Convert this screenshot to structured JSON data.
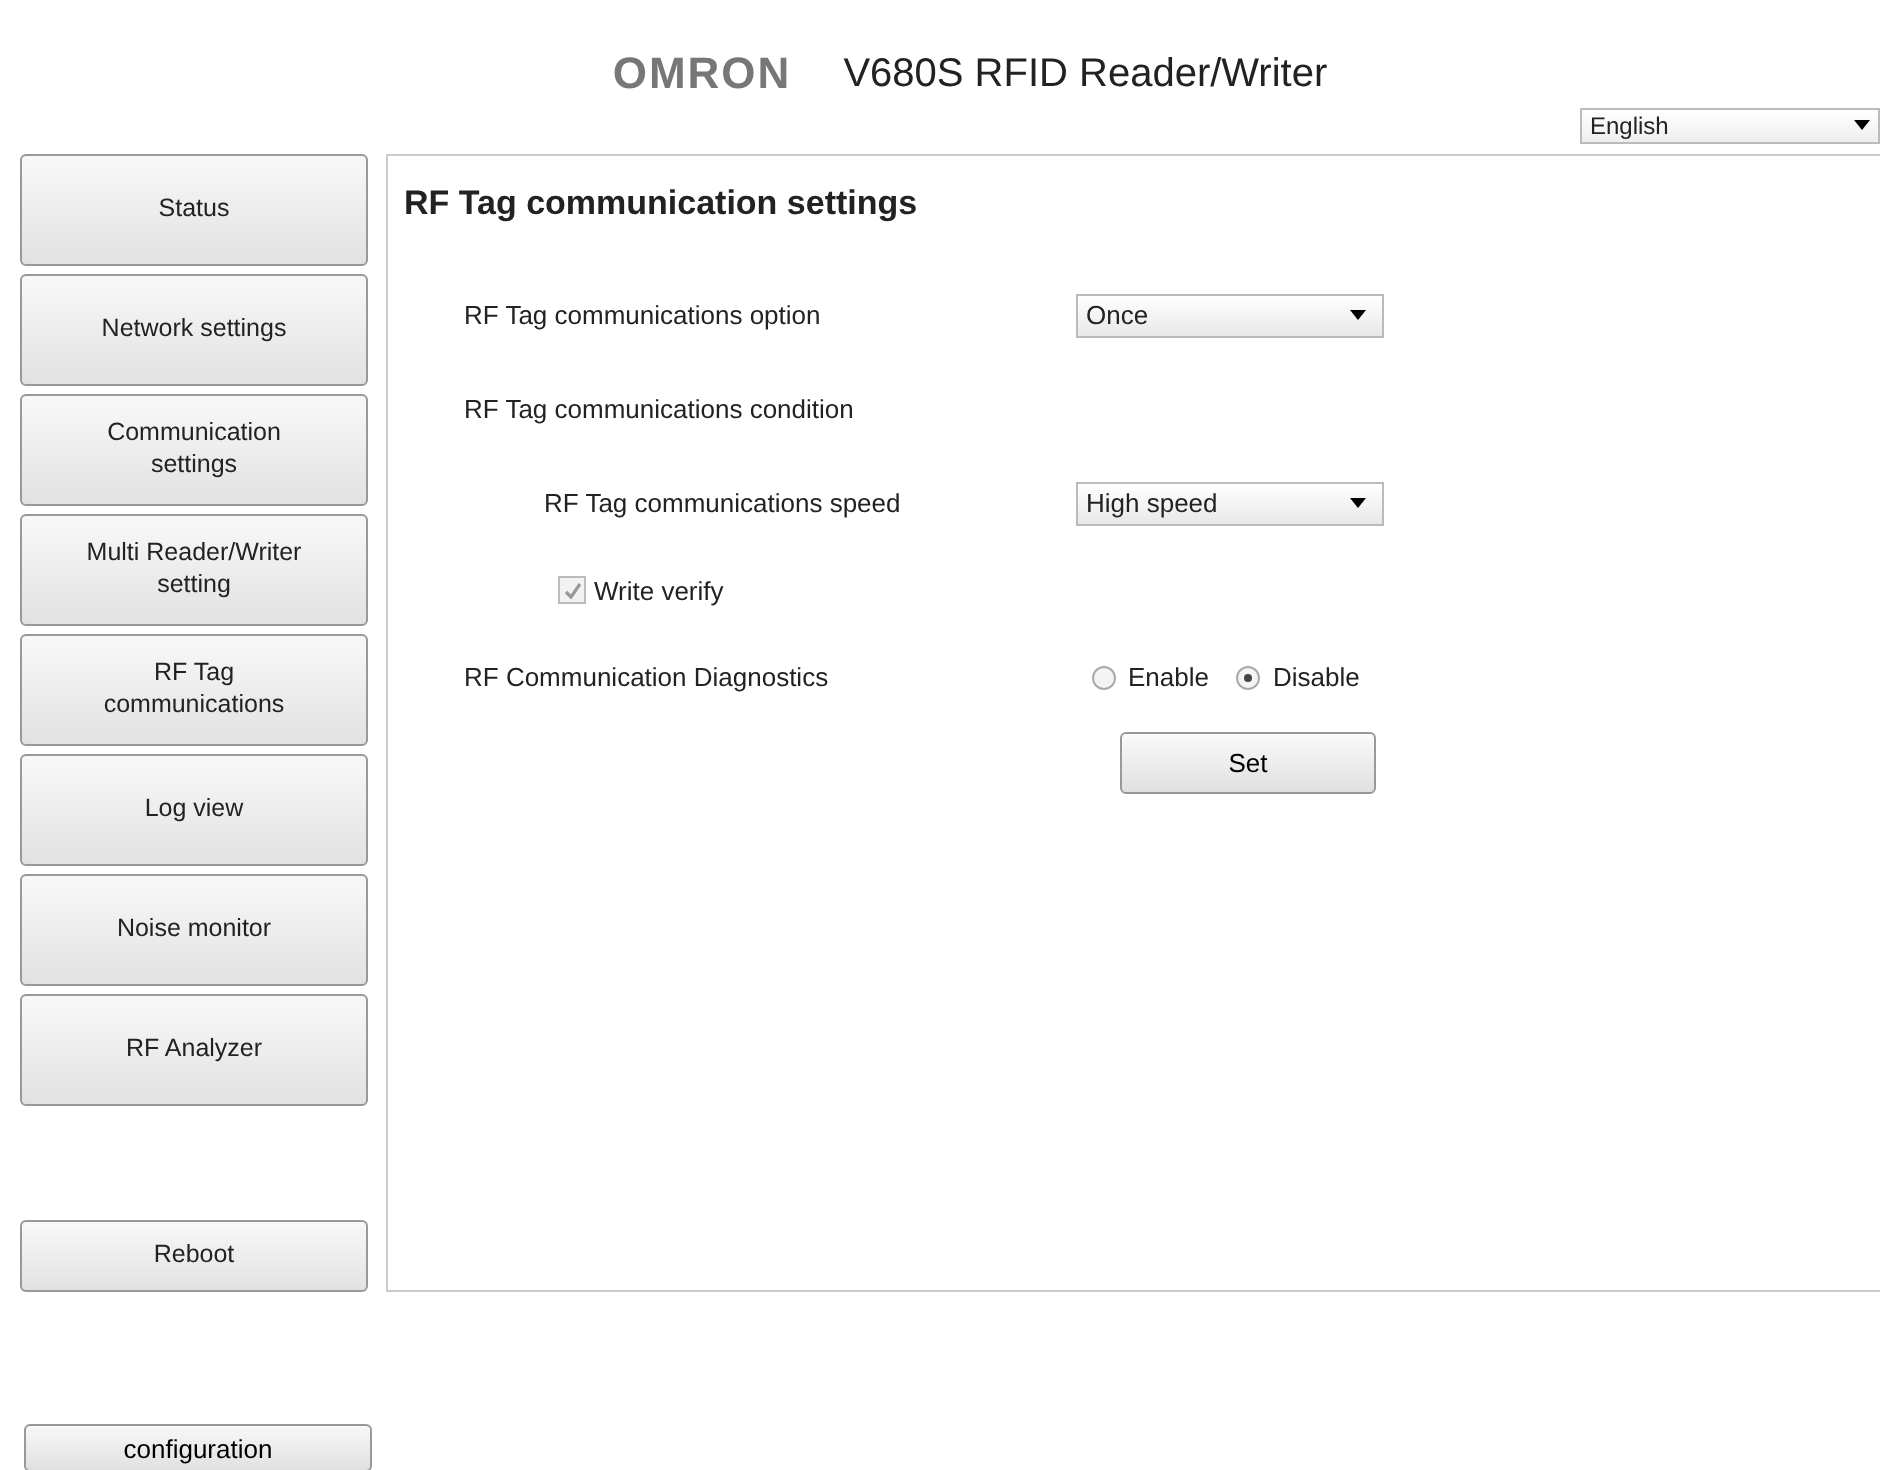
{
  "header": {
    "logo": "OMRON",
    "title": "V680S RFID Reader/Writer"
  },
  "language": {
    "value": "English"
  },
  "sidebar": {
    "items": [
      {
        "label": "Status"
      },
      {
        "label": "Network settings"
      },
      {
        "label": "Communication settings"
      },
      {
        "label": "Multi Reader/Writer setting"
      },
      {
        "label": "RF Tag communications"
      },
      {
        "label": "Log view"
      },
      {
        "label": "Noise monitor"
      },
      {
        "label": "RF Analyzer"
      }
    ],
    "reboot": "Reboot"
  },
  "main": {
    "title": "RF Tag communication settings",
    "rows": [
      {
        "kind": "select",
        "label": "RF Tag communications option",
        "value": "Once",
        "indent": false
      },
      {
        "kind": "heading",
        "label": "RF Tag communications condition"
      },
      {
        "kind": "select",
        "label": "RF Tag communications speed",
        "value": "High speed",
        "indent": true
      },
      {
        "kind": "checkbox",
        "label": "Write verify",
        "checked": true,
        "disabled": true
      },
      {
        "kind": "radio",
        "label": "RF Communication Diagnostics",
        "options": [
          {
            "label": "Enable",
            "selected": false
          },
          {
            "label": "Disable",
            "selected": true
          }
        ]
      }
    ],
    "set_button": "Set"
  },
  "footer_button": "configuration"
}
